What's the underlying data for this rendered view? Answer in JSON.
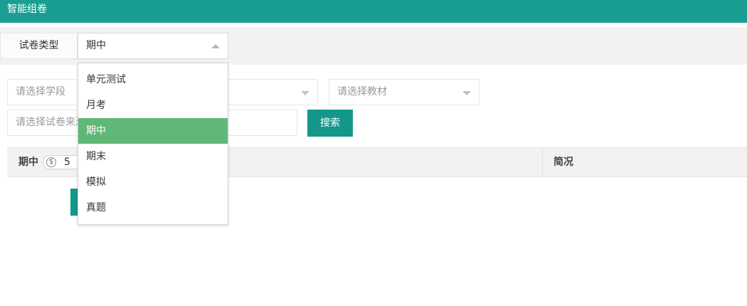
{
  "header": {
    "title": "智能组卷"
  },
  "paper_type": {
    "label": "试卷类型",
    "selected": "期中",
    "options": [
      {
        "label": "单元测试"
      },
      {
        "label": "月考"
      },
      {
        "label": "期中"
      },
      {
        "label": "期末"
      },
      {
        "label": "模拟"
      },
      {
        "label": "真题"
      }
    ]
  },
  "filters": {
    "stage_placeholder": "请选择学段",
    "textbook_placeholder": "请选择教材",
    "source_placeholder": "请选择试卷来源"
  },
  "search": {
    "label": "搜索"
  },
  "table": {
    "name_header": "期中",
    "coin_value": "5",
    "summary_header": "简况"
  },
  "colors": {
    "header_bg": "#1a9e93",
    "button_bg": "#14978b",
    "selected_option_bg": "#5fb878"
  },
  "icons": {
    "coin": "dollar-circle-icon",
    "dropdown_open": "caret-up-icon",
    "dropdown_closed": "caret-down-icon"
  }
}
